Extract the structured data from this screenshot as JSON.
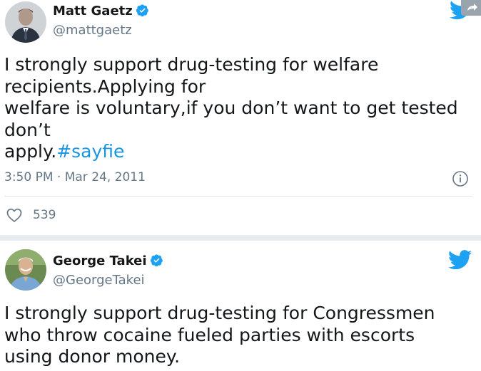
{
  "tweets": [
    {
      "display_name": "Matt Gaetz",
      "handle": "@mattgaetz",
      "text": "I strongly support drug-testing for welfare\nrecipients.Applying for\nwelfare is voluntary,if you don’t want to get tested\ndon’t\napply.",
      "hashtag": "#sayfie",
      "timestamp": "3:50 PM · Mar 24, 2011",
      "like_count": "539",
      "verified": true,
      "icons": [
        "verified-badge-icon",
        "twitter-bird-icon",
        "info-icon",
        "heart-icon",
        "share-icon"
      ]
    },
    {
      "display_name": "George Takei",
      "handle": "@GeorgeTakei",
      "text": "I strongly support drug-testing for Congressmen\nwho throw cocaine fueled parties with escorts\nusing donor money.",
      "verified": true,
      "icons": [
        "verified-badge-icon",
        "twitter-bird-icon"
      ]
    }
  ],
  "colors": {
    "text": "#14171a",
    "secondary_text": "#657786",
    "twitter_blue": "#1da1f2",
    "hashtag": "#1b95e0",
    "divider": "#e1e8ed"
  }
}
